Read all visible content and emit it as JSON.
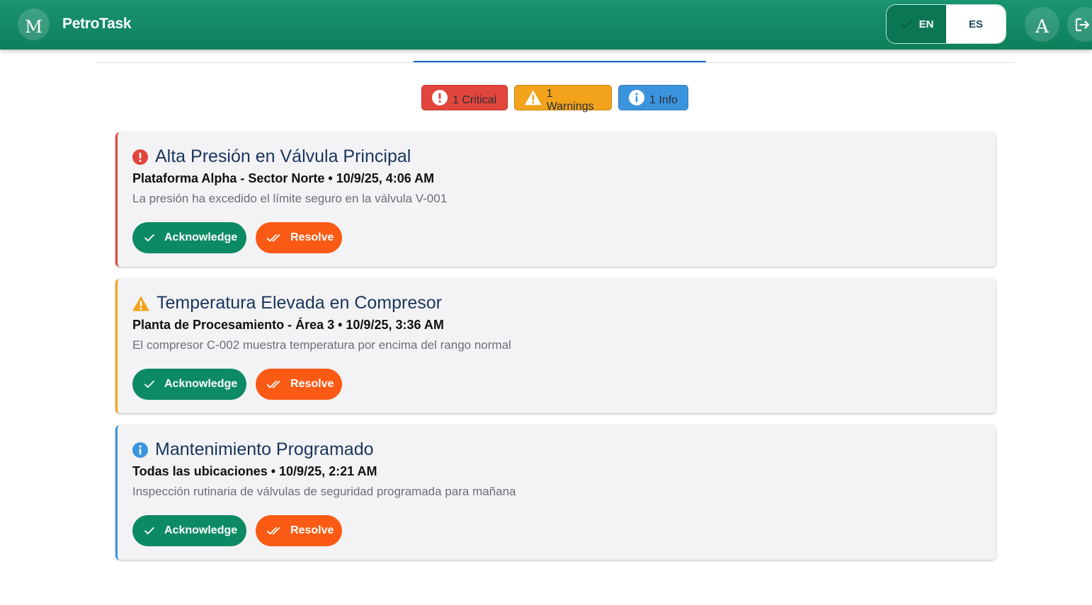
{
  "header": {
    "logo_letter": "M",
    "app_title": "PetroTask",
    "lang": {
      "en_label": "EN",
      "es_label": "ES",
      "active": "EN"
    },
    "avatar_letter": "A",
    "logout_icon": "logout-icon"
  },
  "summary": {
    "critical_label": "1 Critical",
    "warnings_label": "1 Warnings",
    "info_label": "1 Info"
  },
  "alerts": [
    {
      "severity": "critical",
      "icon": "error-icon",
      "title": "Alta Presión en Válvula Principal",
      "meta": "Plataforma Alpha - Sector Norte • 10/9/25, 4:06 AM",
      "description": "La presión ha excedido el límite seguro en la válvula V-001",
      "acknowledge_label": "Acknowledge",
      "resolve_label": "Resolve"
    },
    {
      "severity": "warning",
      "icon": "warning-icon",
      "title": "Temperatura Elevada en Compresor",
      "meta": "Planta de Procesamiento - Área 3 • 10/9/25, 3:36 AM",
      "description": "El compresor C-002 muestra temperatura por encima del rango normal",
      "acknowledge_label": "Acknowledge",
      "resolve_label": "Resolve"
    },
    {
      "severity": "info",
      "icon": "info-icon",
      "title": "Mantenimiento Programado",
      "meta": "Todas las ubicaciones • 10/9/25, 2:21 AM",
      "description": "Inspección rutinaria de válvulas de seguridad programada para mañana",
      "acknowledge_label": "Acknowledge",
      "resolve_label": "Resolve"
    }
  ],
  "colors": {
    "header": "#0d7f5b",
    "critical": "#e2453c",
    "warning": "#f2a31b",
    "info": "#3b94de",
    "acknowledge": "#0c8a63",
    "resolve": "#fb5a14",
    "title": "#19355c"
  }
}
